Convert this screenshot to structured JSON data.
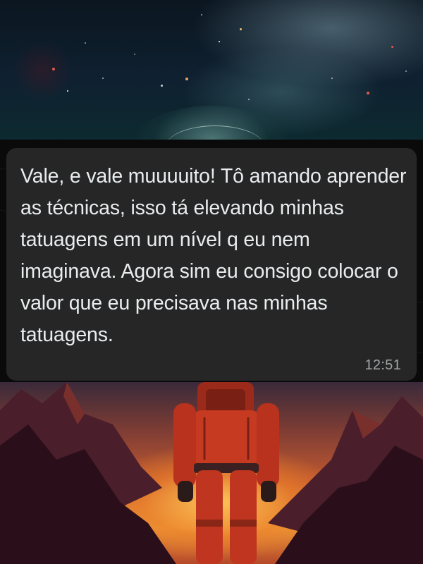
{
  "message": {
    "text": "Vale, e vale muuuuito! Tô amando aprender as técnicas, isso tá elevando minhas tatuagens em um nível q eu nem imaginava. Agora sim eu consigo colocar o valor que eu precisava nas minhas tatuagens.",
    "time": "12:51"
  },
  "wallpaper": {
    "top_image": "space-planet-image",
    "bottom_image": "astronaut-on-red-planet-image",
    "colors": {
      "bubble": "#262626",
      "bubble_text": "#e9edef",
      "timestamp": "#a3a6a8",
      "chat_background": "#0a0a0a",
      "spacesuit": "#c63a22"
    }
  }
}
